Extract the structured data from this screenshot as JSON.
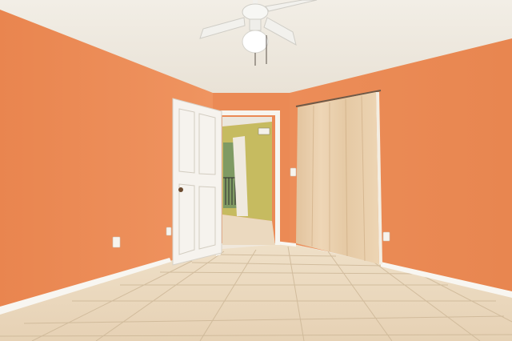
{
  "scene": {
    "description_colors": {
      "ceiling": "#efe9df",
      "wall_left": "#ec8c58",
      "wall_back": "#ea8a55",
      "wall_right": "#ec8f5b",
      "floor_tile": "#ecd9bf",
      "floor_grout": "#cbb69a",
      "door": "#f6f3ee",
      "trim": "#f8f6f1",
      "curtain": "#e8cfae",
      "hall_wall": "#c9bd62",
      "ceiling_fan": "#f7f7f4"
    },
    "icons": [
      "ceiling-fan-icon",
      "door-icon",
      "curtain-icon",
      "outlet-icon",
      "light-switch-icon"
    ]
  }
}
